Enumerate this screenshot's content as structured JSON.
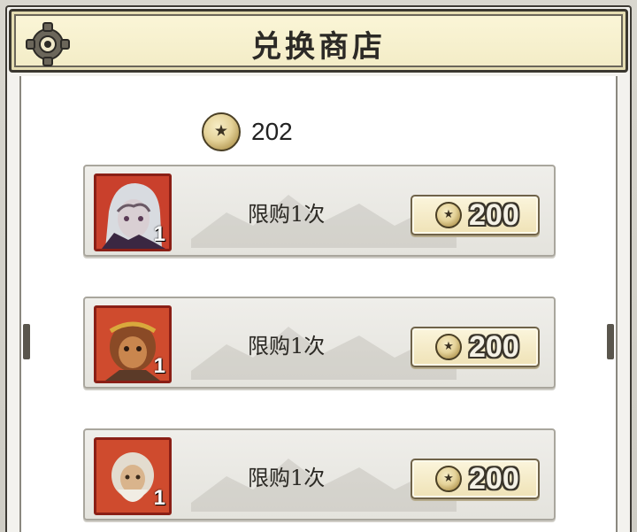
{
  "header": {
    "title": "兑换商店",
    "settings_icon": "gear-icon"
  },
  "balance": {
    "icon": "coin-icon",
    "value": "202"
  },
  "items": [
    {
      "limit_text": "限购1次",
      "quantity": "1",
      "price": "200",
      "price_icon": "coin-icon",
      "portrait": "hero-portrait-silver-hair"
    },
    {
      "limit_text": "限购1次",
      "quantity": "1",
      "price": "200",
      "price_icon": "coin-icon",
      "portrait": "hero-portrait-monkey-king"
    },
    {
      "limit_text": "限购1次",
      "quantity": "1",
      "price": "200",
      "price_icon": "coin-icon",
      "portrait": "hero-portrait-old-sage"
    }
  ],
  "colors": {
    "frame": "#3a372f",
    "header_bg": "#f6f0cc",
    "portrait_border": "#8a1f16",
    "price_text": "#f4f1e6"
  }
}
